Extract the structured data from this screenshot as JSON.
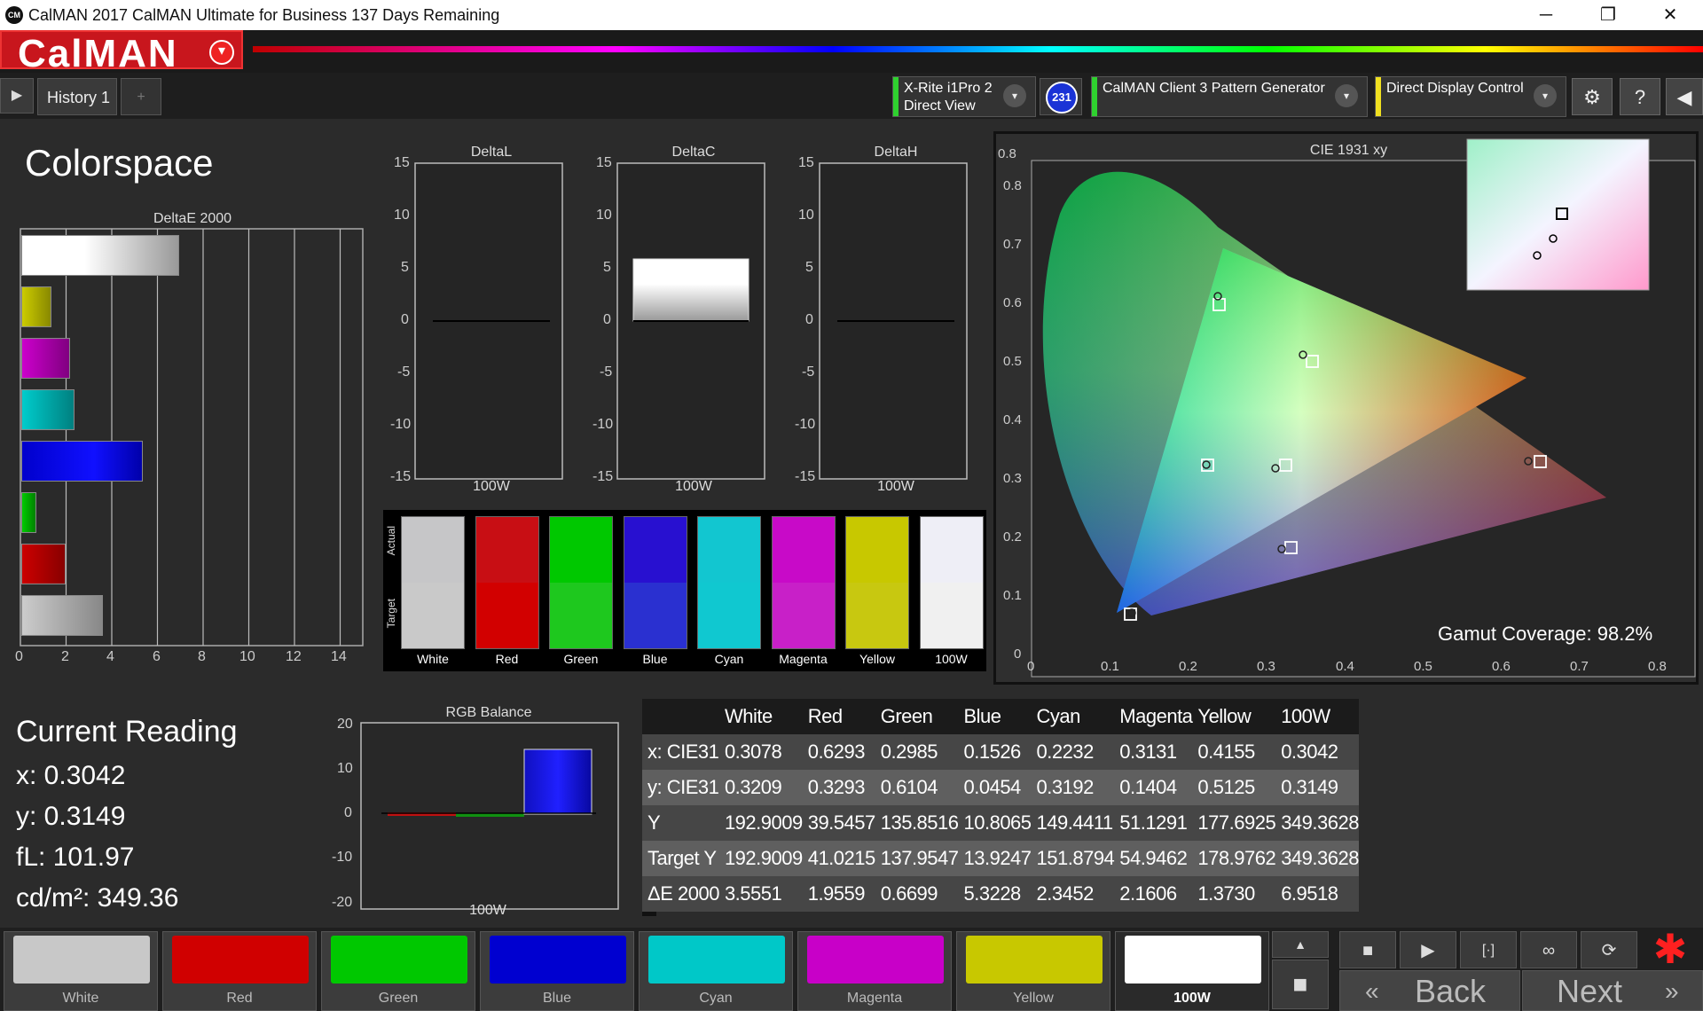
{
  "window": {
    "title": "CalMAN 2017 CalMAN Ultimate for Business 137 Days Remaining",
    "app_icon": "CM",
    "minimize": "─",
    "restore": "❐",
    "close": "✕"
  },
  "logo": {
    "text": "CalMAN",
    "arrow": "▾"
  },
  "tabs": {
    "play": "▶",
    "history": "History 1",
    "add": "+"
  },
  "devices": {
    "meter_line1": "X-Rite i1Pro 2",
    "meter_line2": "Direct View",
    "meter_color": "#2fd12f",
    "badge": "231",
    "generator": "CalMAN Client 3 Pattern Generator",
    "generator_color": "#2fd12f",
    "display": "Direct Display Control",
    "display_color": "#f0e020",
    "dropdown": "▾",
    "settings": "⚙",
    "help": "?",
    "collapse": "◀"
  },
  "page_title": "Colorspace",
  "deltae_chart": {
    "title": "DeltaE 2000",
    "ticks": [
      "0",
      "2",
      "4",
      "6",
      "8",
      "10",
      "12",
      "14"
    ]
  },
  "delta_charts": [
    {
      "title": "DeltaL",
      "category": "100W"
    },
    {
      "title": "DeltaC",
      "category": "100W"
    },
    {
      "title": "DeltaH",
      "category": "100W"
    }
  ],
  "delta_ticks": [
    "15",
    "10",
    "5",
    "0",
    "-5",
    "-10",
    "-15"
  ],
  "swatches": {
    "actual_label": "Actual",
    "target_label": "Target",
    "items": [
      {
        "label": "White",
        "actual": "#c6c6c8",
        "target": "#c9c9c9"
      },
      {
        "label": "Red",
        "actual": "#c80e14",
        "target": "#d20000"
      },
      {
        "label": "Green",
        "actual": "#00c800",
        "target": "#1ec81e"
      },
      {
        "label": "Blue",
        "actual": "#2810d0",
        "target": "#2a30d0"
      },
      {
        "label": "Cyan",
        "actual": "#12c6d0",
        "target": "#10c8d0"
      },
      {
        "label": "Magenta",
        "actual": "#c80ac8",
        "target": "#c820c8"
      },
      {
        "label": "Yellow",
        "actual": "#c8c800",
        "target": "#c8c810"
      },
      {
        "label": "100W",
        "actual": "#eeeef6",
        "target": "#f0f0f0"
      }
    ]
  },
  "cie": {
    "title": "CIE 1931 xy",
    "x_ticks": [
      "0",
      "0.1",
      "0.2",
      "0.3",
      "0.4",
      "0.5",
      "0.6",
      "0.7",
      "0.8"
    ],
    "y_ticks": [
      "0",
      "0.1",
      "0.2",
      "0.3",
      "0.4",
      "0.5",
      "0.6",
      "0.7",
      "0.8"
    ],
    "gamut_label": "Gamut Coverage:",
    "gamut_value": "98.2%"
  },
  "current_reading": {
    "title": "Current Reading",
    "x": "x: 0.3042",
    "y": "y: 0.3149",
    "fl": "fL: 101.97",
    "cdm2": "cd/m²: 349.36"
  },
  "rgb_balance": {
    "title": "RGB Balance",
    "category": "100W",
    "ticks": [
      "20",
      "10",
      "0",
      "-10",
      "-20"
    ]
  },
  "table": {
    "headers": [
      "",
      "White",
      "Red",
      "Green",
      "Blue",
      "Cyan",
      "Magenta",
      "Yellow",
      "100W"
    ],
    "rows": [
      [
        "x: CIE31",
        "0.3078",
        "0.6293",
        "0.2985",
        "0.1526",
        "0.2232",
        "0.3131",
        "0.4155",
        "0.3042"
      ],
      [
        "y: CIE31",
        "0.3209",
        "0.3293",
        "0.6104",
        "0.0454",
        "0.3192",
        "0.1404",
        "0.5125",
        "0.3149"
      ],
      [
        "Y",
        "192.9009",
        "39.5457",
        "135.8516",
        "10.8065",
        "149.4411",
        "51.1291",
        "177.6925",
        "349.3628"
      ],
      [
        "Target Y",
        "192.9009",
        "41.0215",
        "137.9547",
        "13.9247",
        "151.8794",
        "54.9462",
        "178.9762",
        "349.3628"
      ],
      [
        "ΔE 2000",
        "3.5551",
        "1.9559",
        "0.6699",
        "5.3228",
        "2.3452",
        "2.1606",
        "1.3730",
        "6.9518"
      ]
    ]
  },
  "bottom_swatches": [
    {
      "label": "White",
      "color": "#c8c8c8"
    },
    {
      "label": "Red",
      "color": "#d00000"
    },
    {
      "label": "Green",
      "color": "#00c800"
    },
    {
      "label": "Blue",
      "color": "#0000d0"
    },
    {
      "label": "Cyan",
      "color": "#00c8c8"
    },
    {
      "label": "Magenta",
      "color": "#c800c8"
    },
    {
      "label": "Yellow",
      "color": "#c8c800"
    },
    {
      "label": "100W",
      "color": "#ffffff"
    }
  ],
  "controls": {
    "up": "▲",
    "stop_big": "■",
    "stop": "■",
    "play": "▶",
    "bracket": "[·]",
    "loop": "∞",
    "refresh": "⟳",
    "star": "✱",
    "back": "Back",
    "back_arrow": "«",
    "next": "Next",
    "next_arrow": "»"
  }
}
